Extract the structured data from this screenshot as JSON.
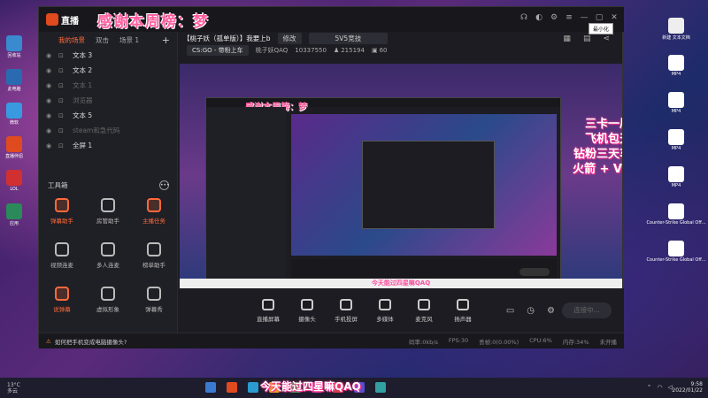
{
  "desktop": {
    "left_icons": [
      {
        "label": "回收站",
        "color": "#3a8ad0"
      },
      {
        "label": "此电脑",
        "color": "#2a6ab0"
      },
      {
        "label": "微软",
        "color": "#3a9ae0"
      },
      {
        "label": "直播伴侣",
        "color": "#e04a1f"
      },
      {
        "label": "LOL",
        "color": "#d03030"
      },
      {
        "label": "应用",
        "color": "#2a8a5a"
      }
    ],
    "right_icons": [
      {
        "label": "新建 文本文档",
        "color": "#eeeeee"
      },
      {
        "label": "MP4",
        "color": "#ffffff"
      },
      {
        "label": "MP4",
        "color": "#ffffff"
      },
      {
        "label": "MP4",
        "color": "#ffffff"
      },
      {
        "label": "MP4",
        "color": "#ffffff"
      },
      {
        "label": "Counter-Strike Global Off...",
        "color": "#ffffff"
      },
      {
        "label": "Counter-Strike Global Off...",
        "color": "#ffffff"
      }
    ]
  },
  "app": {
    "logo_text": "直播",
    "overlay_text": "感谢本周榜：梦",
    "minimize_tooltip": "最小化",
    "scene_tabs": [
      "我的场景",
      "双击",
      "场景 1"
    ],
    "scene_add": "+",
    "sources": [
      {
        "name": "文本 3",
        "dim": false
      },
      {
        "name": "文本 2",
        "dim": false
      },
      {
        "name": "文本 1",
        "dim": true
      },
      {
        "name": "浏览器",
        "dim": true
      },
      {
        "name": "文本 5",
        "dim": false
      },
      {
        "name": "steam和急代码",
        "dim": true
      },
      {
        "name": "全屏 1",
        "dim": false
      }
    ],
    "toolbox_title": "工具箱",
    "tools": [
      {
        "label": "弹幕助手",
        "accent": true
      },
      {
        "label": "房管助手",
        "accent": false
      },
      {
        "label": "主播任务",
        "accent": true
      },
      {
        "label": "视频连麦",
        "accent": false
      },
      {
        "label": "多人连麦",
        "accent": false
      },
      {
        "label": "榜单助手",
        "accent": false
      },
      {
        "label": "说弹幕",
        "accent": true
      },
      {
        "label": "虚拟形象",
        "accent": false
      },
      {
        "label": "弹幕秀",
        "accent": false
      }
    ],
    "help_text": "如何把手机变成电脑摄像头?",
    "stats": [
      "码率:0kb/s",
      "FPS:30",
      "丢帧:0(0.00%)",
      "CPU:6%",
      "内存:34%",
      "未开播"
    ],
    "stream_title": "【桃子妖（孤单版）】我要上b",
    "edit_label": "修改",
    "mode_tag": "5V5竞技",
    "game_tag": "CS:GO - 带粉上车",
    "anchor_name": "桃子妖QAQ",
    "room_id": "10337550",
    "fans": "215194",
    "level": "60",
    "banner_lines": [
      "三卡一局",
      "飞机包天",
      "钻粉三天车",
      "火箭 + VX"
    ],
    "ticker": "今天能过四星嘛QAQ",
    "bottom_buttons": [
      "直播屏幕",
      "摄像头",
      "手机投屏",
      "多媒体",
      "麦克风",
      "扬声器"
    ],
    "go_live": "连接中..."
  },
  "taskbar": {
    "weather_temp": "13°C",
    "weather_desc": "多云",
    "time": "9:58",
    "date": "2022/01/22",
    "subtitle": "今天能过四星嘛QAQ",
    "app_colors": [
      "#3a7ad0",
      "#e04a1f",
      "#2a9ad0",
      "#f0a020",
      "#3aa050",
      "#c03aa0",
      "#d04040",
      "#5050d0",
      "#30a0a0"
    ]
  }
}
